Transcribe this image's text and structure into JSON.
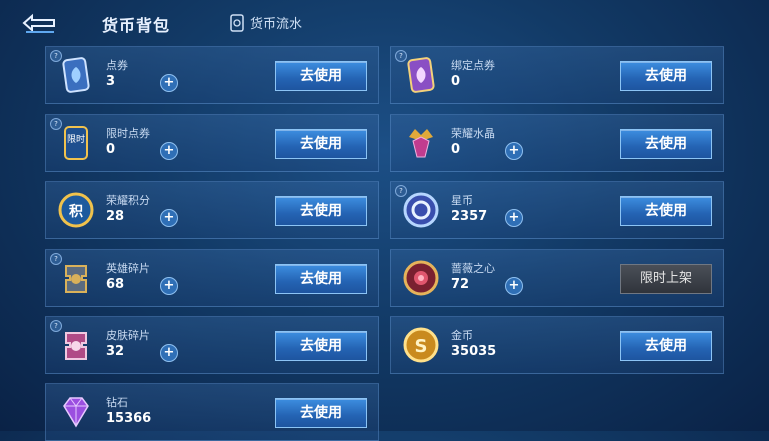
{
  "header": {
    "title": "货币背包",
    "flow_label": "货币流水"
  },
  "items": [
    {
      "name": "点券",
      "value": "3",
      "button": "去使用",
      "icon": "coupon-card-icon"
    },
    {
      "name": "绑定点券",
      "value": "0",
      "button": "去使用",
      "icon": "bound-coupon-icon"
    },
    {
      "name": "限时点券",
      "value": "0",
      "button": "去使用",
      "icon": "limited-coupon-icon",
      "icon_text": "限时"
    },
    {
      "name": "荣耀水晶",
      "value": "0",
      "button": "去使用",
      "icon": "glory-crystal-icon"
    },
    {
      "name": "荣耀积分",
      "value": "28",
      "button": "去使用",
      "icon": "glory-points-icon",
      "icon_text": "积"
    },
    {
      "name": "星币",
      "value": "2357",
      "button": "去使用",
      "icon": "star-coin-icon"
    },
    {
      "name": "英雄碎片",
      "value": "68",
      "button": "去使用",
      "icon": "hero-fragment-icon"
    },
    {
      "name": "蔷薇之心",
      "value": "72",
      "button": "限时上架",
      "icon": "rose-heart-icon"
    },
    {
      "name": "皮肤碎片",
      "value": "32",
      "button": "去使用",
      "icon": "skin-fragment-icon"
    },
    {
      "name": "金币",
      "value": "35035",
      "button": "去使用",
      "icon": "gold-coin-icon",
      "icon_text": "S"
    },
    {
      "name": "钻石",
      "value": "15366",
      "button": "去使用",
      "icon": "diamond-icon"
    }
  ],
  "colors": {
    "button_blue": "#2463b3",
    "card_border": "#6ea0dc",
    "background": "#123a66"
  }
}
